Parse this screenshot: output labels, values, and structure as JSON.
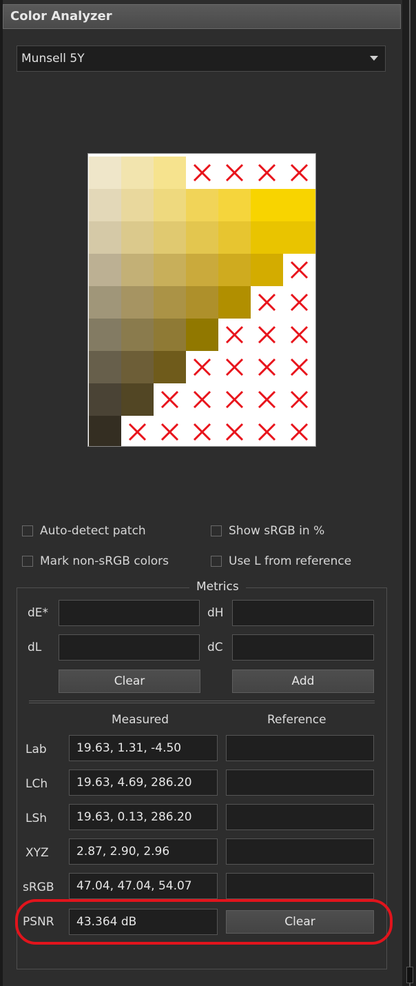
{
  "window": {
    "title": "Color Analyzer"
  },
  "dropdown": {
    "selected": "Munsell 5Y"
  },
  "swatches": {
    "rows": [
      [
        "#efe6c9",
        "#f2e4ae",
        "#f6e38e",
        null,
        null,
        null,
        null
      ],
      [
        "#e3d8b8",
        "#e9d89d",
        "#eed97e",
        "#f1d458",
        "#f5d53c",
        "#f8d400",
        "#f8d400"
      ],
      [
        "#d5c9a7",
        "#dbc98c",
        "#e0c970",
        "#e3c64f",
        "#e7c530",
        "#e9c400",
        "#e9c400"
      ],
      [
        "#bcb093",
        "#c3b076",
        "#c8af5a",
        "#caaa3c",
        "#cfab1f",
        "#d3ac00",
        null
      ],
      [
        "#a09679",
        "#a69462",
        "#ab9346",
        "#ae902b",
        "#b18f00",
        null,
        null
      ],
      [
        "#837b63",
        "#8a7b4d",
        "#8f7a35",
        "#917800",
        null,
        null,
        null
      ],
      [
        "#675f4b",
        "#6d5e37",
        "#6f5b1b",
        null,
        null,
        null,
        null
      ],
      [
        "#4a4335",
        "#524624",
        null,
        null,
        null,
        null,
        null
      ],
      [
        "#342e22",
        null,
        null,
        null,
        null,
        null,
        null
      ]
    ]
  },
  "options": {
    "auto_detect": "Auto-detect patch",
    "show_srgb": "Show sRGB in %",
    "mark_non_srgb": "Mark non-sRGB colors",
    "use_l_ref": "Use L from reference"
  },
  "metrics": {
    "title": "Metrics",
    "de_label": "dE*",
    "dh_label": "dH",
    "dl_label": "dL",
    "dc_label": "dC",
    "clear_label": "Clear",
    "add_label": "Add",
    "measured_header": "Measured",
    "reference_header": "Reference",
    "rows": [
      {
        "label": "Lab",
        "measured": "19.63, 1.31, -4.50",
        "reference": ""
      },
      {
        "label": "LCh",
        "measured": "19.63, 4.69, 286.20",
        "reference": ""
      },
      {
        "label": "LSh",
        "measured": "19.63, 0.13, 286.20",
        "reference": ""
      },
      {
        "label": "XYZ",
        "measured": "2.87, 2.90, 2.96",
        "reference": ""
      },
      {
        "label": "sRGB",
        "measured": "47.04, 47.04, 54.07",
        "reference": ""
      }
    ],
    "psnr_label": "PSNR",
    "psnr_value": "43.364 dB",
    "psnr_clear": "Clear"
  },
  "colors": {
    "cross": "#e8141c",
    "highlight": "#e1141c"
  }
}
